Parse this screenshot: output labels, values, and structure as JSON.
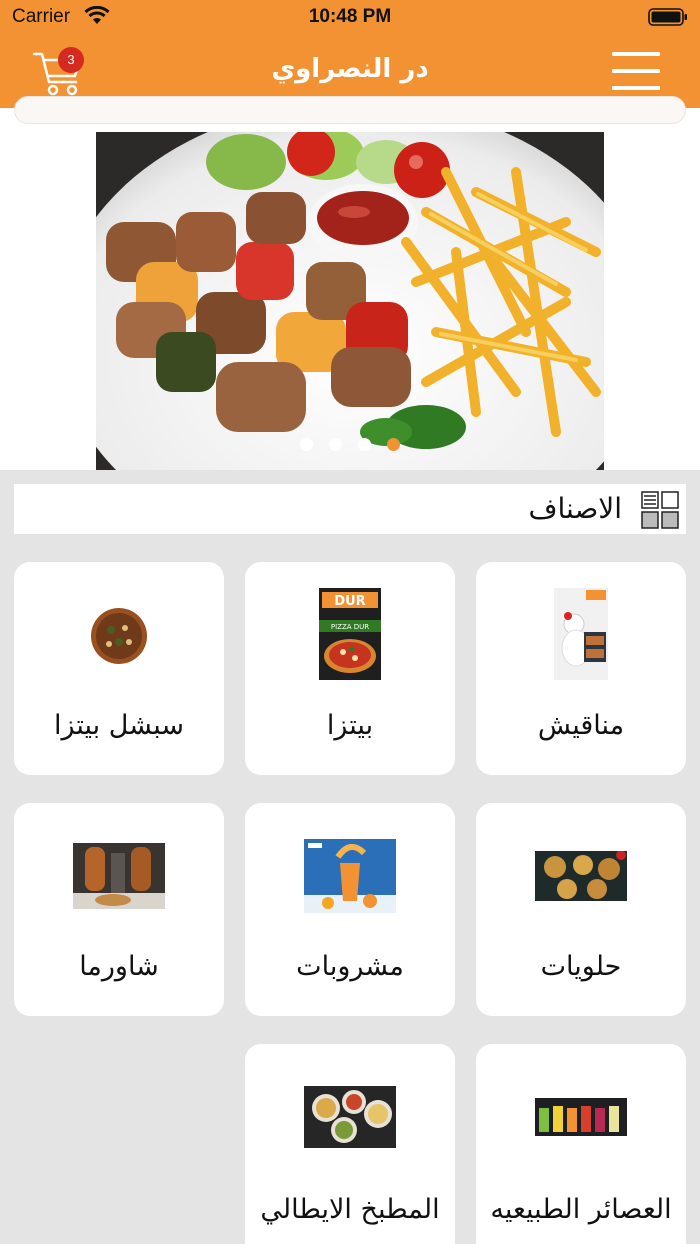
{
  "status_bar": {
    "carrier": "Carrier",
    "time": "10:48 PM"
  },
  "header": {
    "title": "در النصراوي",
    "cart_count": "3"
  },
  "banner": {
    "slide_count": 4,
    "active_slide": 4
  },
  "categories_section": {
    "title": "الاصناف"
  },
  "categories": [
    {
      "label": "مناقيش",
      "thumb": "manakish-thumbnail"
    },
    {
      "label": "بيتزا",
      "thumb": "pizza-thumbnail"
    },
    {
      "label": "سبشل بيتزا",
      "thumb": "special-pizza-thumbnail"
    },
    {
      "label": "حلويات",
      "thumb": "sweets-thumbnail"
    },
    {
      "label": "مشروبات",
      "thumb": "drinks-thumbnail"
    },
    {
      "label": "شاورما",
      "thumb": "shawarma-thumbnail"
    },
    {
      "label": "العصائر الطبيعيه",
      "thumb": "juices-thumbnail"
    },
    {
      "label": "المطبخ الايطالي",
      "thumb": "italian-kitchen-thumbnail"
    }
  ],
  "pizza_thumb_text": {
    "brand": "DUR",
    "caption": "PIZZA DUR"
  },
  "colors": {
    "accent": "#f39233",
    "badge": "#d42a1f",
    "background": "#e4e4e4"
  }
}
